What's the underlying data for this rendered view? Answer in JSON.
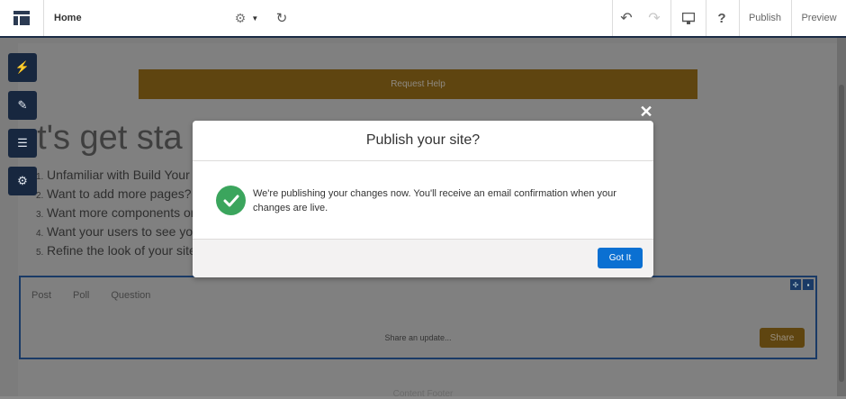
{
  "toolbar": {
    "page_name": "Home",
    "publish_label": "Publish",
    "preview_label": "Preview",
    "help_label": "?"
  },
  "canvas": {
    "banner_label": "Request Help",
    "hero_title": "et's get sta",
    "steps": [
      {
        "num": "1.",
        "text": "Unfamiliar with Build Your"
      },
      {
        "num": "2.",
        "text": "Want to add more pages? T"
      },
      {
        "num": "3.",
        "text": "Want more components on"
      },
      {
        "num": "4.",
        "text": "Want your users to see you"
      },
      {
        "num": "5.",
        "text": "Refine the look of your site"
      }
    ],
    "feed": {
      "tabs": [
        "Post",
        "Poll",
        "Question"
      ],
      "share_placeholder": "Share an update...",
      "share_button": "Share"
    },
    "footer_text": "Content Footer"
  },
  "modal": {
    "title": "Publish your site?",
    "message": "We're publishing your changes now. You'll receive an email confirmation when your changes are live.",
    "confirm_label": "Got It"
  },
  "colors": {
    "toolbar_border": "#1b2b45",
    "brand_brown": "#5f4510",
    "primary_blue": "#0b70d2",
    "success_green": "#3ba55d"
  },
  "icons": {
    "app": "layout-icon",
    "gear": "gear-icon",
    "refresh": "refresh-icon",
    "undo": "undo-icon",
    "redo": "redo-icon",
    "device": "desktop-icon",
    "close": "close-icon",
    "success": "check-icon"
  }
}
